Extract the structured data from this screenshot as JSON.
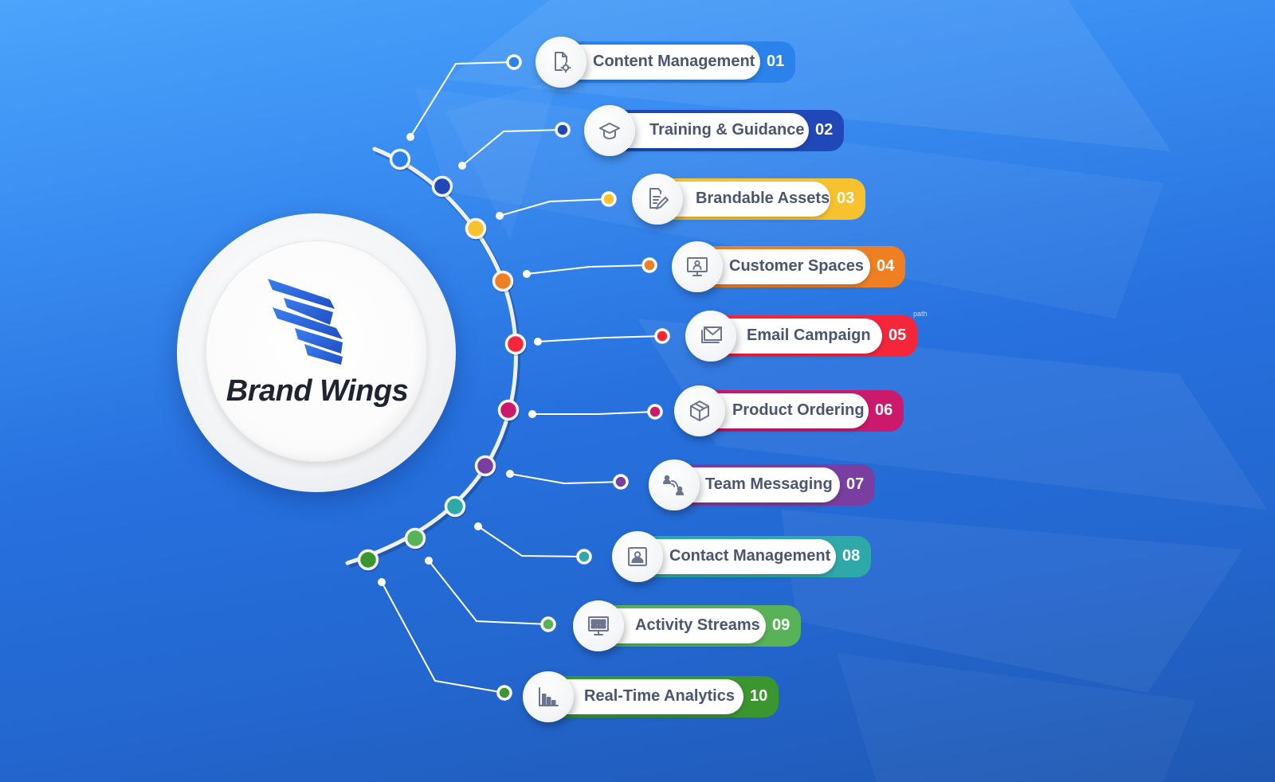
{
  "brand": {
    "name": "Brand Wings",
    "logo_icon": "wing-stripes-logo"
  },
  "colors": {
    "background_top": "#4ca4fb",
    "background_bottom": "#1f58b2",
    "label_text": "#4a5570",
    "icon_stroke": "#6b7590"
  },
  "annotation": {
    "text": "path"
  },
  "features": [
    {
      "number": "01",
      "label": "Content Management",
      "icon": "document-gear-icon",
      "color": "#2a82ea"
    },
    {
      "number": "02",
      "label": "Training & Guidance",
      "icon": "graduation-cap-icon",
      "color": "#2048b8"
    },
    {
      "number": "03",
      "label": "Brandable Assets",
      "icon": "document-edit-icon",
      "color": "#f8c22e"
    },
    {
      "number": "04",
      "label": "Customer Spaces",
      "icon": "monitor-user-icon",
      "color": "#ee7f22"
    },
    {
      "number": "05",
      "label": "Email Campaign",
      "icon": "mail-stack-icon",
      "color": "#f5253a"
    },
    {
      "number": "06",
      "label": "Product Ordering",
      "icon": "package-box-icon",
      "color": "#cb1a6c"
    },
    {
      "number": "07",
      "label": "Team Messaging",
      "icon": "team-chat-icon",
      "color": "#7a3ea0"
    },
    {
      "number": "08",
      "label": "Contact Management",
      "icon": "contact-card-icon",
      "color": "#2ea8a8"
    },
    {
      "number": "09",
      "label": "Activity Streams",
      "icon": "dashboard-monitor-icon",
      "color": "#58b358"
    },
    {
      "number": "10",
      "label": "Real-Time Analytics",
      "icon": "bar-chart-icon",
      "color": "#3b962f"
    }
  ]
}
